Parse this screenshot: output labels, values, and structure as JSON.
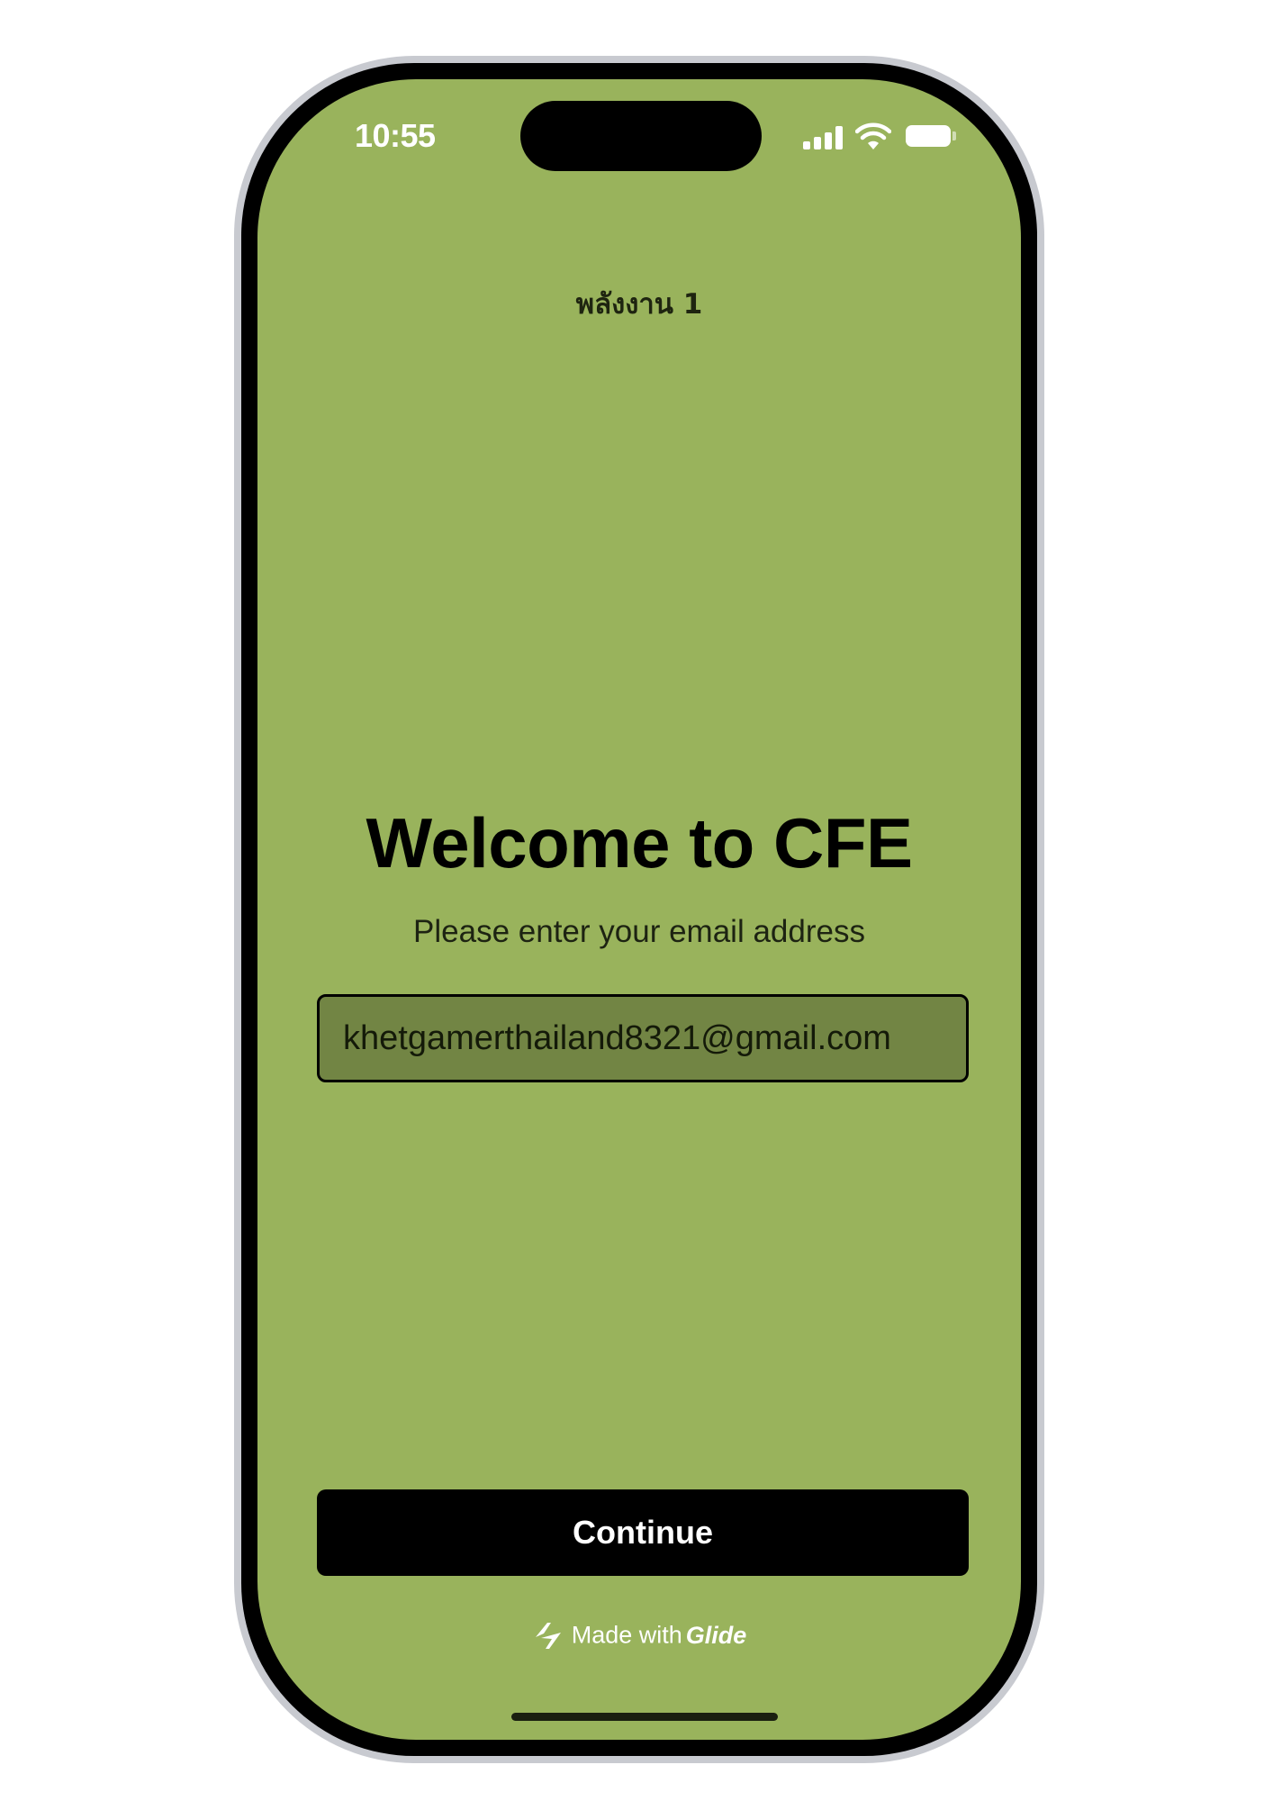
{
  "status_bar": {
    "time": "10:55",
    "signal_icon": "cellular-signal-icon",
    "wifi_icon": "wifi-icon",
    "battery_icon": "battery-icon"
  },
  "app": {
    "title": "พลังงาน 1"
  },
  "main": {
    "heading": "Welcome to CFE",
    "prompt": "Please enter your email address",
    "email_value": "khetgamerthailand8321@gmail.com",
    "continue_label": "Continue"
  },
  "footer": {
    "made_with_label": "Made with",
    "brand": "Glide",
    "icon": "glide-logo-icon"
  },
  "colors": {
    "screen_background": "#99b35c",
    "input_background": "#728544",
    "button_background": "#000000",
    "button_text": "#ffffff"
  }
}
